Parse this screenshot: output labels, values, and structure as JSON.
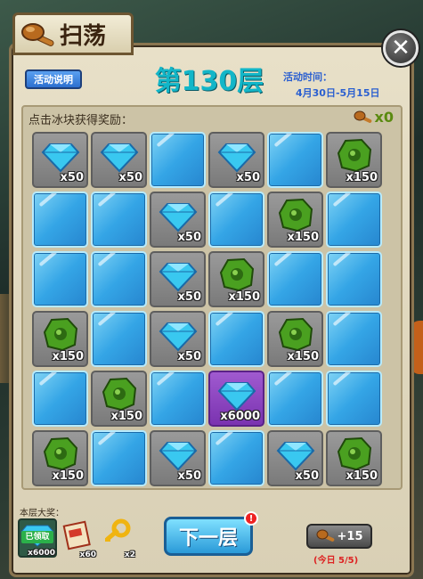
{
  "header": {
    "title": "扫荡"
  },
  "info_button": "活动说明",
  "floor_title": "第130层",
  "event_time": {
    "label": "活动时间：",
    "range": "4月30日-5月15日"
  },
  "grid": {
    "caption": "点击冰块获得奖励：",
    "key_count": "x0",
    "rows": [
      [
        {
          "t": "diamond",
          "q": "x50"
        },
        {
          "t": "diamond",
          "q": "x50"
        },
        {
          "t": "ice"
        },
        {
          "t": "diamond",
          "q": "x50"
        },
        {
          "t": "ice"
        },
        {
          "t": "jade",
          "q": "x150"
        }
      ],
      [
        {
          "t": "ice"
        },
        {
          "t": "ice"
        },
        {
          "t": "diamond",
          "q": "x50"
        },
        {
          "t": "ice"
        },
        {
          "t": "jade",
          "q": "x150"
        },
        {
          "t": "ice"
        }
      ],
      [
        {
          "t": "ice"
        },
        {
          "t": "ice"
        },
        {
          "t": "diamond",
          "q": "x50"
        },
        {
          "t": "jade",
          "q": "x150"
        },
        {
          "t": "ice"
        },
        {
          "t": "ice"
        }
      ],
      [
        {
          "t": "jade",
          "q": "x150"
        },
        {
          "t": "ice"
        },
        {
          "t": "diamond",
          "q": "x50"
        },
        {
          "t": "ice"
        },
        {
          "t": "jade",
          "q": "x150"
        },
        {
          "t": "ice"
        }
      ],
      [
        {
          "t": "ice"
        },
        {
          "t": "jade",
          "q": "x150"
        },
        {
          "t": "ice"
        },
        {
          "t": "grand",
          "q": "x6000"
        },
        {
          "t": "ice"
        },
        {
          "t": "ice"
        }
      ],
      [
        {
          "t": "jade",
          "q": "x150"
        },
        {
          "t": "ice"
        },
        {
          "t": "diamond",
          "q": "x50"
        },
        {
          "t": "ice"
        },
        {
          "t": "diamond",
          "q": "x50"
        },
        {
          "t": "jade",
          "q": "x150"
        }
      ]
    ]
  },
  "grand_prize": {
    "label": "本层大奖：",
    "items": [
      {
        "icon": "diamond-icon",
        "qty": "x6000",
        "claimed": "已领取"
      },
      {
        "icon": "scroll-icon",
        "qty": "x60"
      },
      {
        "icon": "key-icon",
        "qty": "x2"
      }
    ]
  },
  "next_button": "下一层",
  "alert": "!",
  "plus_button": "+15",
  "today_count": "(今日 5/5)",
  "colors": {
    "accent": "#12b6c8",
    "time": "#2a5fd0",
    "ice": "#34a5e6",
    "jade": "#4aa020",
    "diamond": "#39c8f0"
  }
}
